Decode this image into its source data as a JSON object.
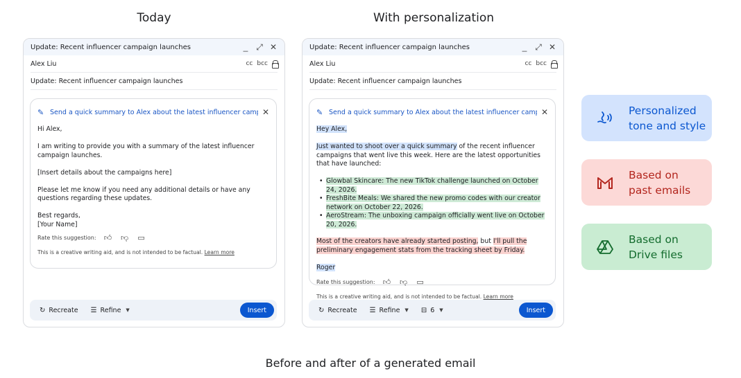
{
  "columns": {
    "today": "Today",
    "personalized": "With personalization"
  },
  "caption": "Before and after of a generated email",
  "window": {
    "title": "Update: Recent influencer campaign launches",
    "minimize": "_",
    "expand": "⤢",
    "close": "✕",
    "recipient": "Alex Liu",
    "cc": "cc",
    "bcc": "bcc",
    "subject": "Update: Recent influencer campaign launches"
  },
  "prompt": "Send a quick summary to Alex about the latest influencer campaign l...",
  "today_email": {
    "greeting": "Hi Alex,",
    "p1": "I am writing to provide you with a summary of the latest influencer campaign launches.",
    "p2": "[Insert details about the campaigns here]",
    "p3": "Please let me know if you need any additional details or have any questions regarding these updates.",
    "closing": "Best regards,",
    "signature": "[Your Name]"
  },
  "personal_email": {
    "greeting": "Hey Alex,",
    "p1_highlight": "Just wanted to shoot over a quick summary",
    "p1_rest": " of the recent influencer campaigns that went live this week. Here are the latest opportunities that have launched:",
    "bullets": [
      "Glowbal Skincare: The new TikTok challenge launched on October 24, 2026.",
      "FreshBite Meals: We shared the new promo codes with our creator network on October 22, 2026.",
      "AeroStream: The unboxing campaign officially went live on October 20, 2026."
    ],
    "p3_a": "Most of the creators have already started posting,",
    "p3_sep": " but ",
    "p3_b": "I'll pull the preliminary engagement stats from the tracking sheet by Friday.",
    "signature": "Roger"
  },
  "rate_label": "Rate this suggestion:",
  "disclaimer": "This is a creative writing aid, and is not intended to be factual.",
  "learn_more": "Learn more",
  "toolbar": {
    "recreate": "Recreate",
    "refine": "Refine",
    "sources_count": "6",
    "insert": "Insert"
  },
  "features": [
    {
      "label": "Personalized\ntone and style",
      "icon": "voice-style-icon",
      "bg": "#d3e3fd",
      "fg": "#0b57d0"
    },
    {
      "label": "Based on\npast emails",
      "icon": "gmail-icon",
      "bg": "#fcd9d7",
      "fg": "#b3261e"
    },
    {
      "label": "Based on\nDrive files",
      "icon": "drive-icon",
      "bg": "#c9ecd2",
      "fg": "#146c2e"
    }
  ]
}
